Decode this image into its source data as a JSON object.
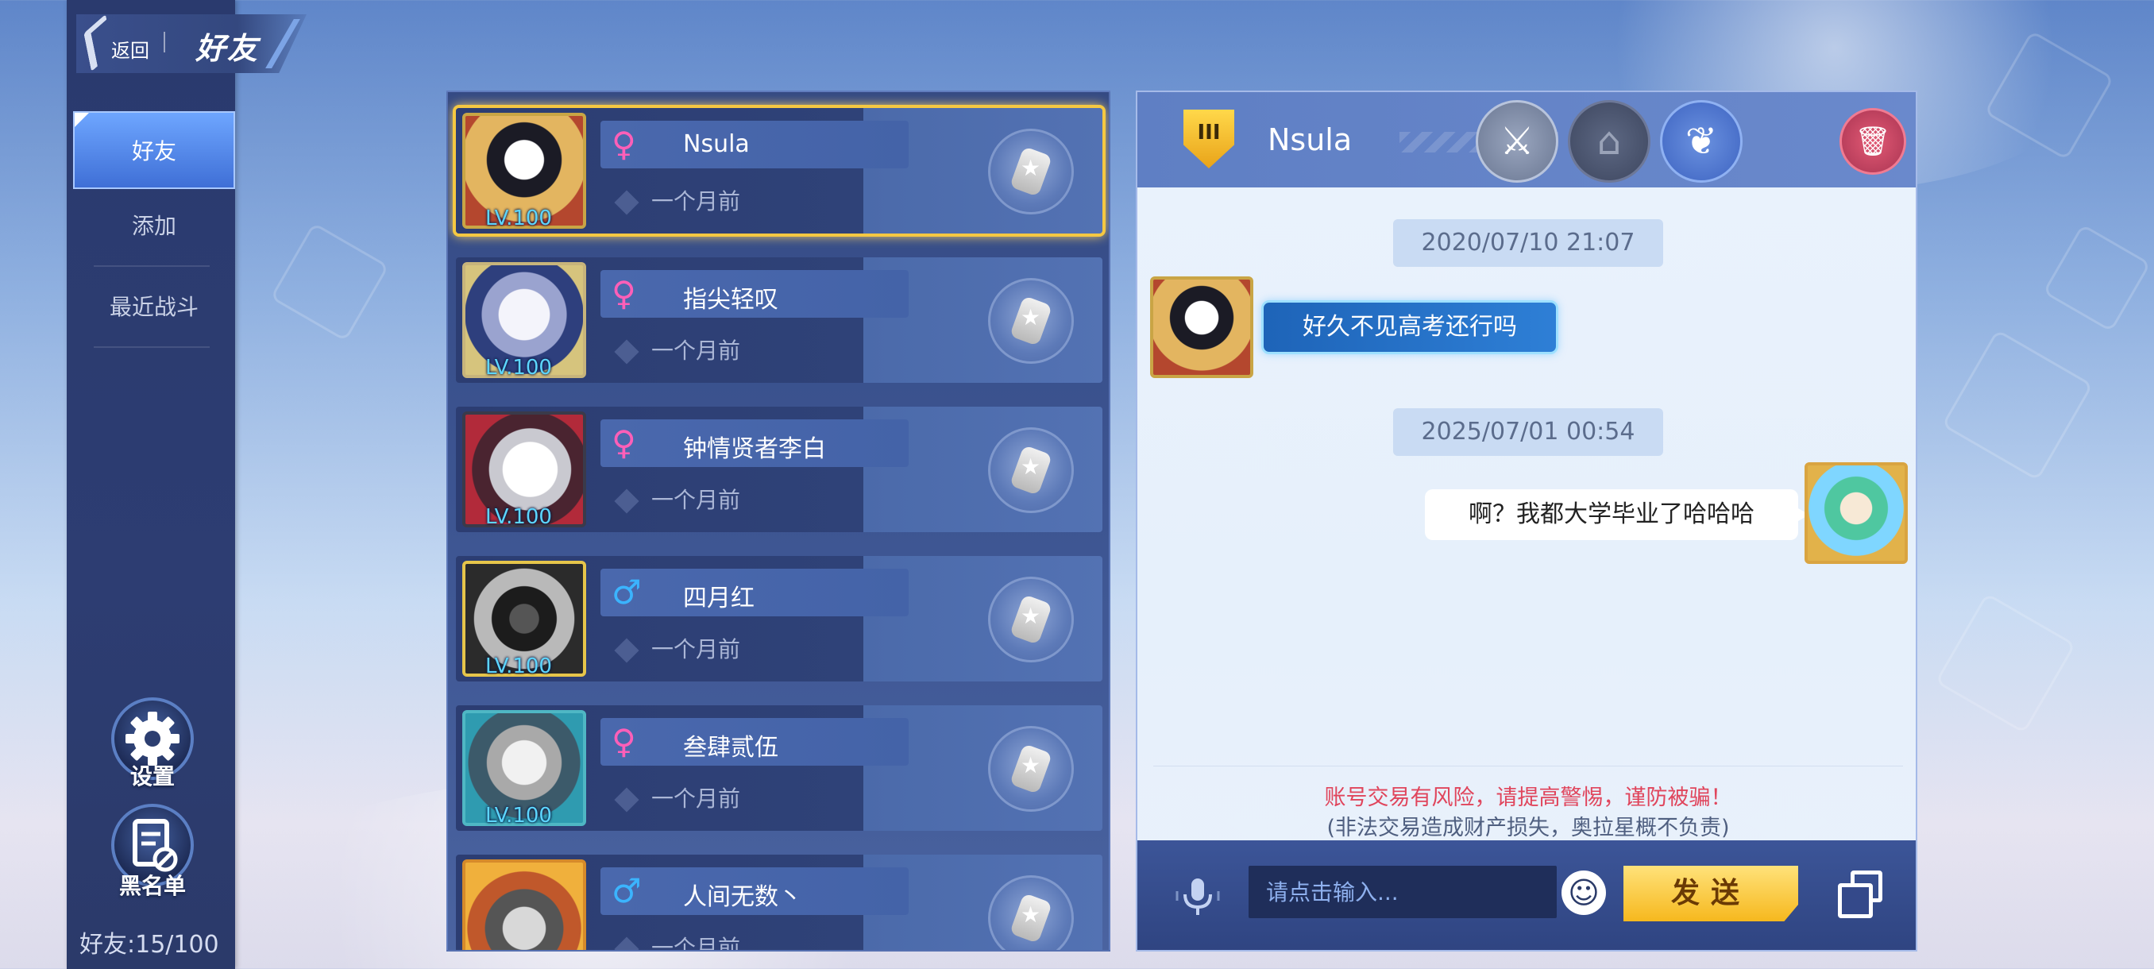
{
  "header": {
    "back_label": "返回",
    "title": "好友"
  },
  "sidebar": {
    "tabs": [
      {
        "label": "好友",
        "active": true
      },
      {
        "label": "添加",
        "active": false
      },
      {
        "label": "最近战斗",
        "active": false
      }
    ],
    "settings_label": "设置",
    "blacklist_label": "黑名单",
    "friend_count": "好友:15/100"
  },
  "friends": [
    {
      "name": "Nsula",
      "gender": "female",
      "gender_symbol": "♀",
      "level": "LV.100",
      "last_seen": "一个月前",
      "selected": true
    },
    {
      "name": "指尖轻叹",
      "gender": "female",
      "gender_symbol": "♀",
      "level": "LV.100",
      "last_seen": "一个月前",
      "selected": false
    },
    {
      "name": "钟情贤者李白",
      "gender": "female",
      "gender_symbol": "♀",
      "level": "LV.100",
      "last_seen": "一个月前",
      "selected": false
    },
    {
      "name": "四月红",
      "gender": "male",
      "gender_symbol": "♂",
      "level": "LV.100",
      "last_seen": "一个月前",
      "selected": false
    },
    {
      "name": "叁肆贰伍",
      "gender": "female",
      "gender_symbol": "♀",
      "level": "LV.100",
      "last_seen": "一个月前",
      "selected": false
    },
    {
      "name": "人间无数丶",
      "gender": "male",
      "gender_symbol": "♂",
      "level": "",
      "last_seen": "一个月前",
      "selected": false
    }
  ],
  "chat": {
    "rank_label": "III",
    "partner_name": "Nsula",
    "icons": [
      "crossed-swords-icon",
      "home-icon",
      "plant-icon",
      "trash-icon"
    ],
    "messages": [
      {
        "timestamp": "2020/07/10 21:07",
        "direction": "incoming",
        "text": "好久不见高考还行吗"
      },
      {
        "timestamp": "2025/07/01 00:54",
        "direction": "outgoing",
        "text": "啊？我都大学毕业了哈哈哈"
      }
    ],
    "warning_line1": "账号交易有风险，请提高警惕，谨防被骗！",
    "warning_line2": "(非法交易造成财产损失，奥拉星概不负责)",
    "input_placeholder": "请点击输入...",
    "send_label": "发送"
  },
  "colors": {
    "female": "#ff5fb8",
    "male": "#3bb4ff",
    "selected_outline": "#f5c842",
    "warning": "#e0455c",
    "send_button": "#f6b81e"
  }
}
